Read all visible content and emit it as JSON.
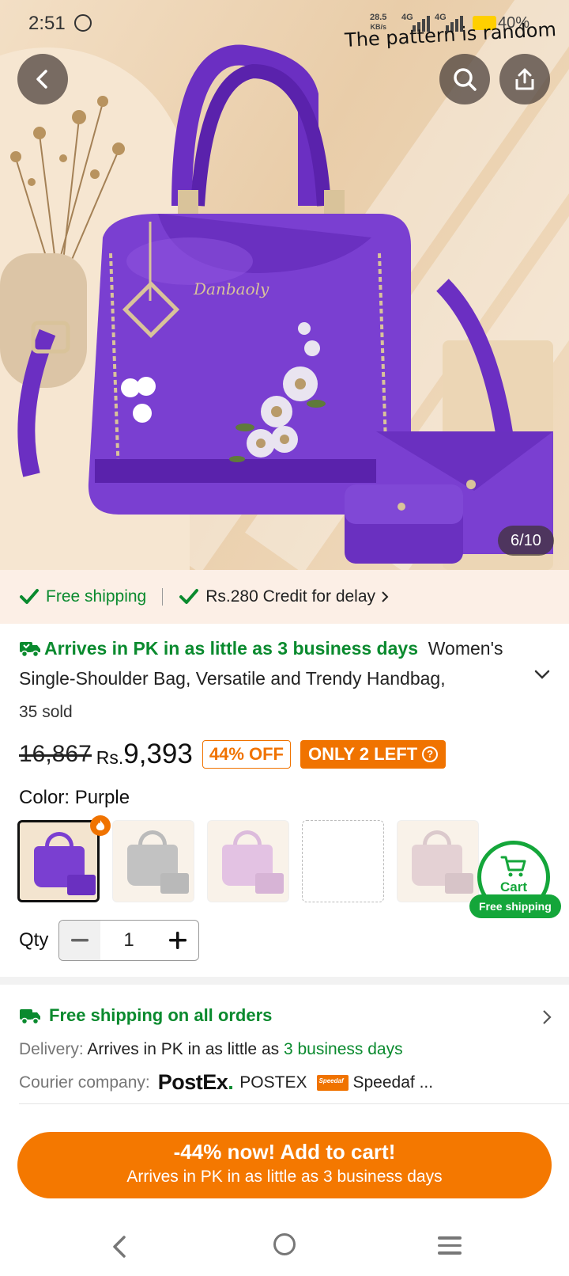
{
  "status_bar": {
    "time": "2:51",
    "net_speed": "28.5",
    "net_unit": "KB/s",
    "sim1": "4G",
    "sim2": "4G",
    "battery": "40%"
  },
  "hero": {
    "caption": "The pattern is random",
    "counter": "6/10",
    "brand_text": "Danbaoly"
  },
  "shipping_strip": {
    "free_shipping": "Free shipping",
    "credit": "Rs.280 Credit for delay"
  },
  "product": {
    "arrival": "Arrives in PK in as little as 3 business days",
    "title": "Women's Single-Shoulder Bag, Versatile and Trendy Handbag,",
    "sold": "35 sold",
    "old_price": "16,867",
    "currency": "Rs.",
    "price": "9,393",
    "discount": "44% OFF",
    "stock": "ONLY 2 LEFT",
    "stock_help": "?",
    "color_label": "Color: Purple",
    "qty_label": "Qty",
    "qty_value": "1"
  },
  "swatches": [
    {
      "color": "#7a3fd1",
      "selected": true
    },
    {
      "color": "#8a8a8a",
      "selected": false
    },
    {
      "color": "#c98ac8",
      "selected": false
    },
    {
      "color": "#ffffff",
      "selected": false
    },
    {
      "color": "#c9a0a8",
      "selected": false
    }
  ],
  "cart_float": {
    "label": "Cart",
    "pill": "Free shipping"
  },
  "delivery": {
    "free_all": "Free shipping on all orders",
    "delivery_label": "Delivery:",
    "delivery_text": "Arrives in PK in as little as",
    "delivery_days": "3 business days",
    "courier_label": "Courier company:",
    "postex_logo": "PostEx",
    "postex_logo_dot": ".",
    "postex_name": "POSTEX",
    "speedaf_logo": "Speedaf",
    "speedaf_name": "Speedaf ..."
  },
  "cta": {
    "main": "-44% now! Add to cart!",
    "sub": "Arrives in PK in as little as 3 business days"
  },
  "colors": {
    "accent_orange": "#f47800",
    "green": "#0a8a2e",
    "cart_green": "#14a63a",
    "product_purple": "#7a3fd1"
  }
}
